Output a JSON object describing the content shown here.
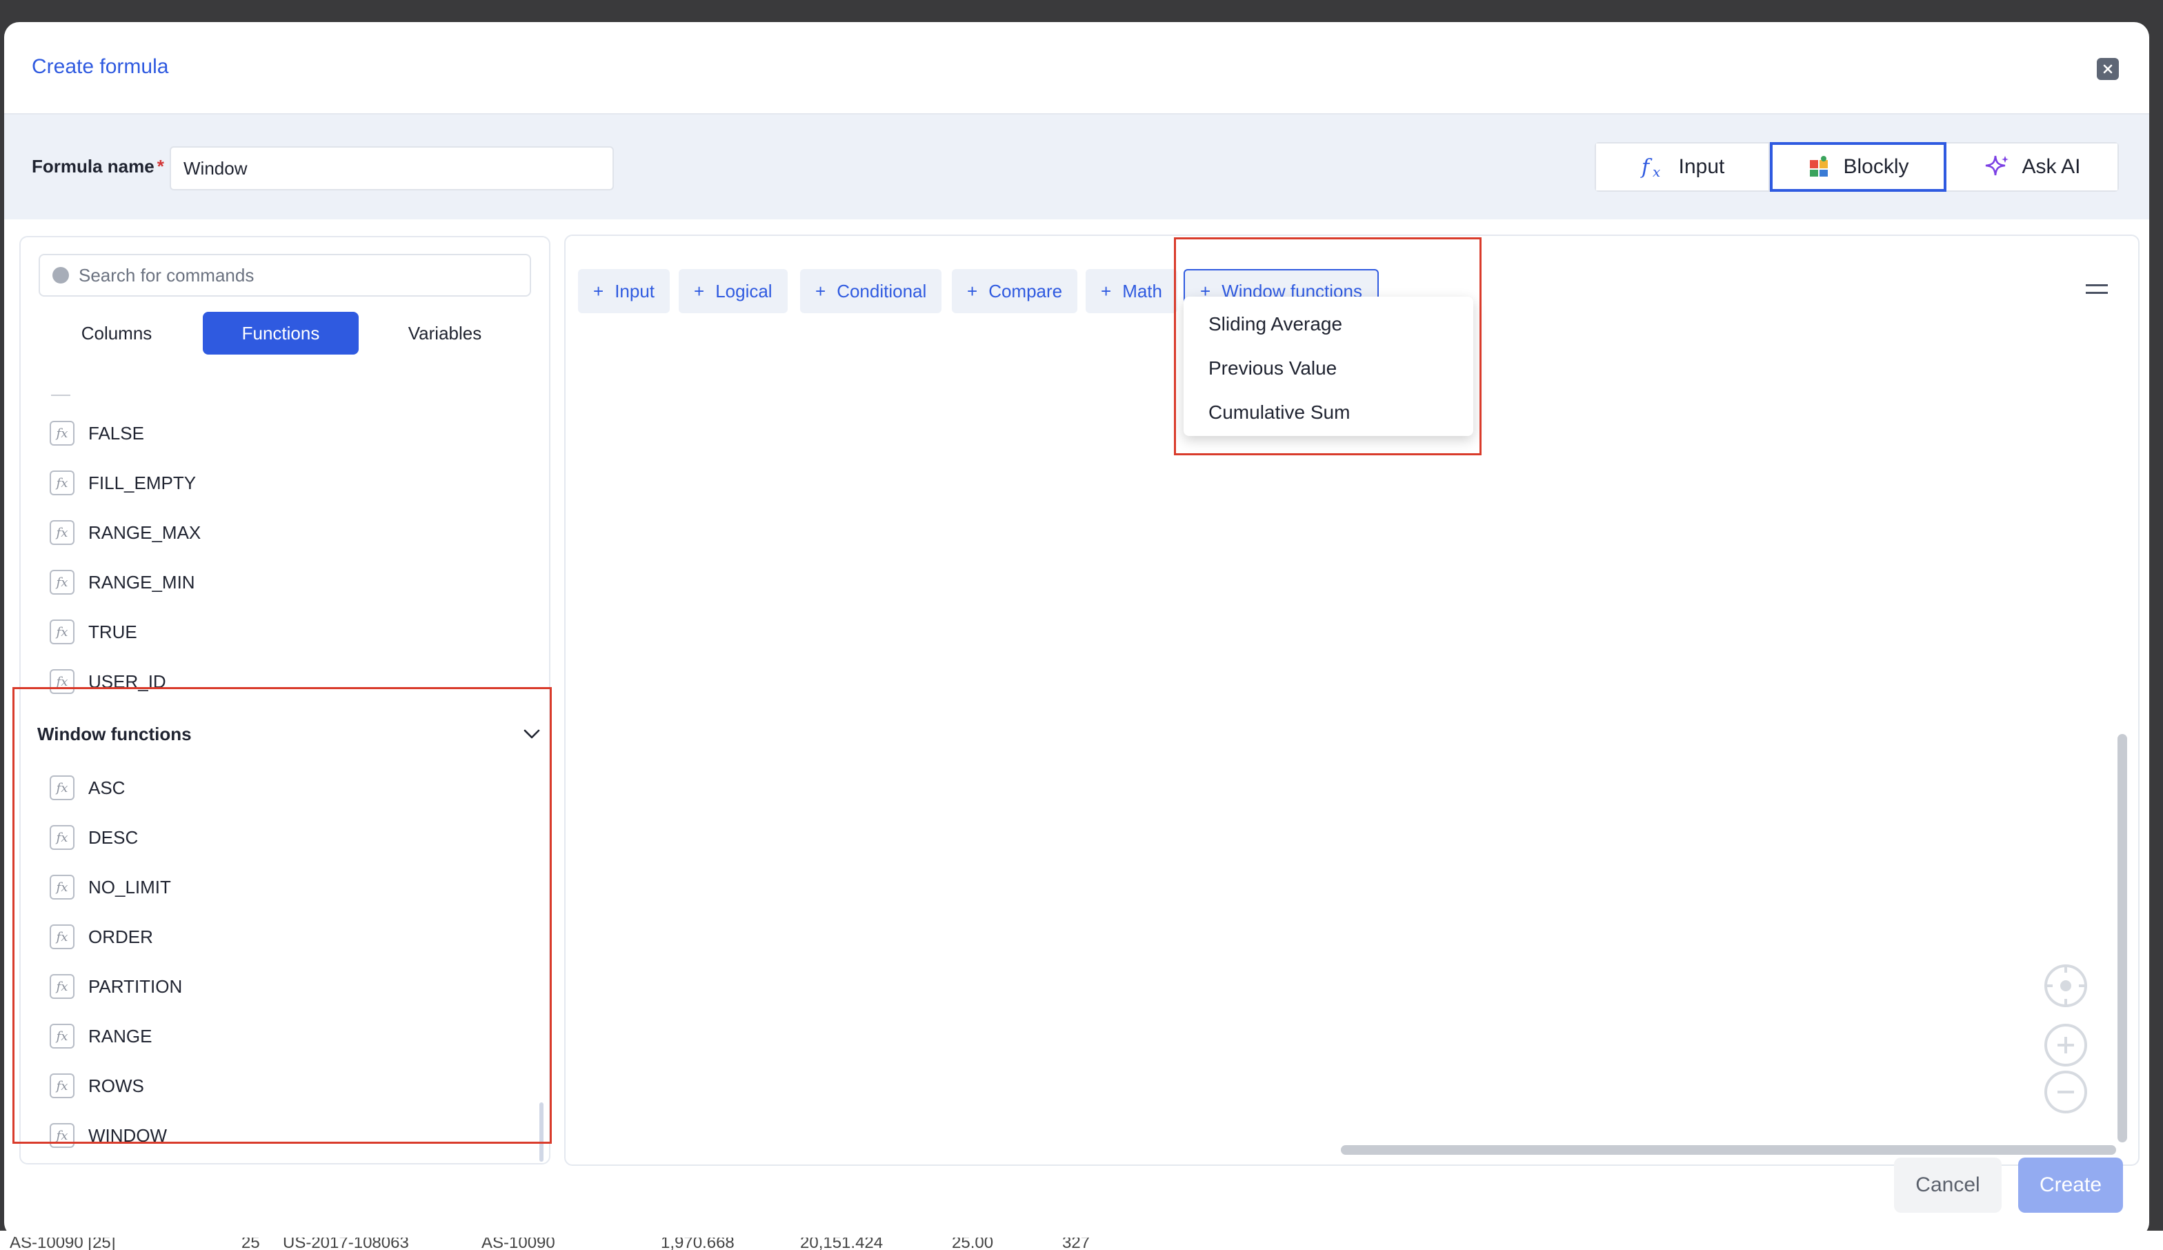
{
  "background_row": {
    "cells": [
      "AS-10090 [25]",
      "25",
      "US-2017-108063",
      "AS-10090",
      "1,970.668",
      "20,151.424",
      "25.00",
      "327"
    ]
  },
  "modal": {
    "title": "Create formula",
    "close_icon": "close-icon"
  },
  "name_bar": {
    "label": "Formula name",
    "required_mark": "*",
    "value": "Window",
    "modes": [
      {
        "label": "Input",
        "icon": "fx-icon"
      },
      {
        "label": "Blockly",
        "icon": "puzzle-icon"
      },
      {
        "label": "Ask AI",
        "icon": "sparkle-icon"
      }
    ],
    "active_mode": "Blockly"
  },
  "left_panel": {
    "search_placeholder": "Search for commands",
    "tabs": [
      "Columns",
      "Functions",
      "Variables"
    ],
    "active_tab": "Functions",
    "functions_above": [
      "FALSE",
      "FILL_EMPTY",
      "RANGE_MAX",
      "RANGE_MIN",
      "TRUE",
      "USER_ID"
    ],
    "section_title": "Window functions",
    "window_functions": [
      "ASC",
      "DESC",
      "NO_LIMIT",
      "ORDER",
      "PARTITION",
      "RANGE",
      "ROWS",
      "WINDOW"
    ]
  },
  "canvas": {
    "categories": [
      {
        "label": "Input"
      },
      {
        "label": "Logical"
      },
      {
        "label": "Conditional"
      },
      {
        "label": "Compare"
      },
      {
        "label": "Math"
      },
      {
        "label": "Window functions"
      }
    ],
    "dropdown_items": [
      "Sliding Average",
      "Previous Value",
      "Cumulative Sum"
    ]
  },
  "footer": {
    "cancel_label": "Cancel",
    "create_label": "Create"
  },
  "colors": {
    "accent": "#2f5ae0",
    "highlight": "#d93b2b",
    "create_disabled": "#93abf1"
  }
}
